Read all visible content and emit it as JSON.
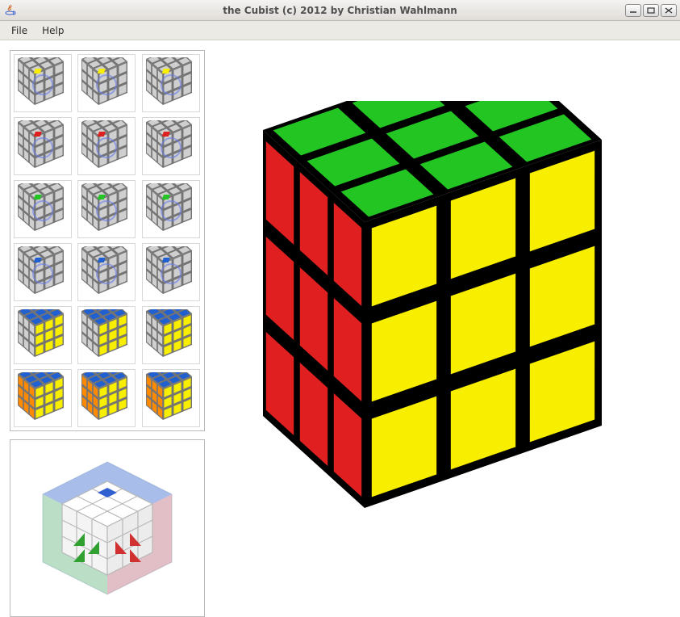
{
  "window": {
    "title": "the Cubist (c) 2012 by Christian Wahlmann",
    "icon": "java-coffee-icon",
    "minimize": "_",
    "maximize": "□",
    "close": "×"
  },
  "menu": {
    "file": "File",
    "help": "Help"
  },
  "palette": {
    "top": "#22c522",
    "front": "#f7ee00",
    "left": "#e02020",
    "gray": "#cfcfcf",
    "blue": "#2060d0",
    "orange": "#ff8a00",
    "white": "#ffffff",
    "edge": "#000000"
  },
  "main_cube": {
    "top_face": "top",
    "front_face": "front",
    "left_face": "left"
  },
  "thumbnails": [
    {
      "name": "move-step-1",
      "top": "gray",
      "front": "gray",
      "left": "gray",
      "accent": "front"
    },
    {
      "name": "move-step-2",
      "top": "gray",
      "front": "gray",
      "left": "gray",
      "accent": "front"
    },
    {
      "name": "move-step-3",
      "top": "gray",
      "front": "gray",
      "left": "gray",
      "accent": "front"
    },
    {
      "name": "move-step-4",
      "top": "gray",
      "front": "gray",
      "left": "gray",
      "accent": "left"
    },
    {
      "name": "move-step-5",
      "top": "gray",
      "front": "gray",
      "left": "gray",
      "accent": "left"
    },
    {
      "name": "move-step-6",
      "top": "gray",
      "front": "gray",
      "left": "gray",
      "accent": "left"
    },
    {
      "name": "move-step-7",
      "top": "gray",
      "front": "gray",
      "left": "gray",
      "accent": "top"
    },
    {
      "name": "move-step-8",
      "top": "gray",
      "front": "gray",
      "left": "gray",
      "accent": "top"
    },
    {
      "name": "move-step-9",
      "top": "gray",
      "front": "gray",
      "left": "gray",
      "accent": "top"
    },
    {
      "name": "move-step-10",
      "top": "gray",
      "front": "gray",
      "left": "gray",
      "accent": "blue"
    },
    {
      "name": "move-step-11",
      "top": "gray",
      "front": "gray",
      "left": "gray",
      "accent": "blue"
    },
    {
      "name": "move-step-12",
      "top": "gray",
      "front": "gray",
      "left": "gray",
      "accent": "blue"
    },
    {
      "name": "move-step-13",
      "top": "blue",
      "front": "front",
      "left": "gray",
      "accent": "none"
    },
    {
      "name": "move-step-14",
      "top": "blue",
      "front": "front",
      "left": "gray",
      "accent": "none"
    },
    {
      "name": "move-step-15",
      "top": "blue",
      "front": "front",
      "left": "gray",
      "accent": "none"
    },
    {
      "name": "move-step-16",
      "top": "blue",
      "front": "front",
      "left": "orange",
      "accent": "none"
    },
    {
      "name": "move-step-17",
      "top": "blue",
      "front": "front",
      "left": "orange",
      "accent": "none"
    },
    {
      "name": "move-step-18",
      "top": "blue",
      "front": "front",
      "left": "orange",
      "accent": "none"
    }
  ],
  "preview": {
    "name": "cube-orientation-preview"
  }
}
